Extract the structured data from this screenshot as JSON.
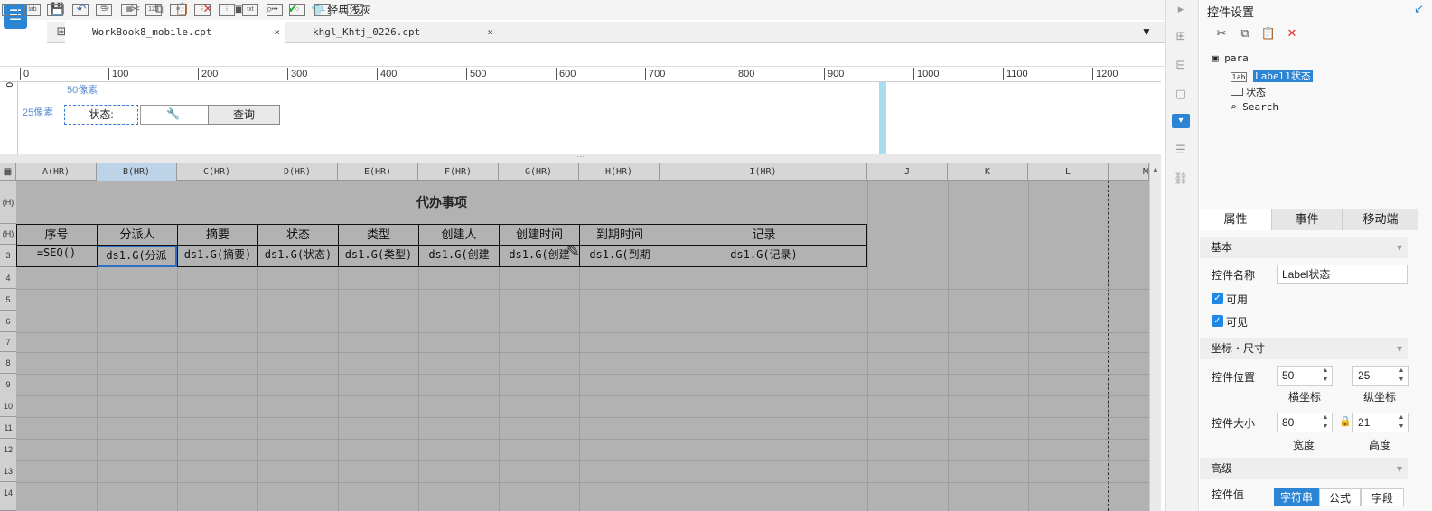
{
  "app": {
    "tool_text": "经典浅灰"
  },
  "tabs": [
    {
      "label": "WorkBook8_mobile.cpt"
    },
    {
      "label": "khgl_Khtj_0226.cpt"
    }
  ],
  "icons": {
    "close": "×",
    "dropdown": "▾",
    "wrench": "🔧"
  },
  "ruler": [
    "0",
    "100",
    "200",
    "300",
    "400",
    "500",
    "600",
    "700",
    "800",
    "900",
    "1000",
    "1100",
    "1200"
  ],
  "param_panel": {
    "px50": "50像素",
    "px25": "25像素",
    "vruler_zero": "0",
    "label_text": "状态:",
    "button_text": "查询"
  },
  "columns": [
    "A(HR)",
    "B(HR)",
    "C(HR)",
    "D(HR)",
    "E(HR)",
    "F(HR)",
    "G(HR)",
    "H(HR)",
    "I(HR)",
    "J",
    "K",
    "L",
    "M"
  ],
  "rows": [
    "(H)",
    "(H)",
    "3",
    "4",
    "5",
    "6",
    "7",
    "8",
    "9",
    "10",
    "11",
    "12",
    "13",
    "14"
  ],
  "sheet": {
    "title": "代办事项",
    "headers": [
      "序号",
      "分派人",
      "摘要",
      "状态",
      "类型",
      "创建人",
      "创建时间",
      "到期时间",
      "记录"
    ],
    "cells": [
      "=SEQ()",
      "ds1.G(分派",
      "ds1.G(摘要)",
      "ds1.G(状态)",
      "ds1.G(类型)",
      "ds1.G(创建",
      "ds1.G(创建",
      "ds1.G(到期",
      "ds1.G(记录)"
    ]
  },
  "panel": {
    "title": "控件设置",
    "tree": {
      "root": "para",
      "items": [
        "Label1状态",
        "状态",
        "Search"
      ]
    },
    "tabs": [
      "属性",
      "事件",
      "移动端"
    ],
    "sections": {
      "basic": "基本",
      "coords": "坐标・尺寸",
      "advanced": "高级"
    },
    "name_label": "控件名称",
    "name_value": "Label状态",
    "enabled": "可用",
    "visible": "可见",
    "pos_label": "控件位置",
    "x": "50",
    "y": "25",
    "x_label": "横坐标",
    "y_label": "纵坐标",
    "size_label": "控件大小",
    "w": "80",
    "h": "21",
    "w_label": "宽度",
    "h_label": "高度",
    "value_label": "控件值",
    "value_types": [
      "字符串",
      "公式",
      "字段"
    ]
  }
}
